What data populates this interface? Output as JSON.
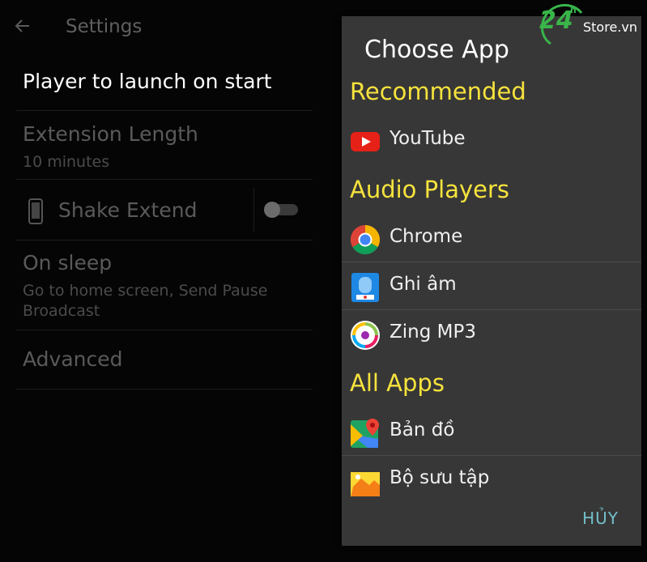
{
  "settings": {
    "title": "Settings",
    "player_title": "Player to launch on start",
    "extension_title": "Extension Length",
    "extension_value": "10 minutes",
    "shake_title": "Shake Extend",
    "shake_enabled": false,
    "sleep_title": "On sleep",
    "sleep_value": "Go to home screen, Send Pause Broadcast",
    "advanced_title": "Advanced"
  },
  "dialog": {
    "title": "Choose App",
    "sections": [
      {
        "title": "Recommended",
        "apps": [
          {
            "label": "YouTube",
            "icon": "youtube-icon"
          }
        ]
      },
      {
        "title": "Audio Players",
        "apps": [
          {
            "label": "Chrome",
            "icon": "chrome-icon"
          },
          {
            "label": "Ghi âm",
            "icon": "recorder-icon"
          },
          {
            "label": "Zing MP3",
            "icon": "zing-mp3-icon"
          }
        ]
      },
      {
        "title": "All Apps",
        "apps": [
          {
            "label": "Bản đồ",
            "icon": "maps-icon"
          },
          {
            "label": "Bộ sưu tập",
            "icon": "gallery-icon"
          }
        ]
      }
    ],
    "cancel_label": "HỦY"
  },
  "watermark": {
    "number": "24",
    "superscript": "h",
    "text": "Store.vn"
  },
  "colors": {
    "section_heading": "#f6e33d",
    "cancel": "#73bfc9",
    "dialog_bg": "#373737"
  }
}
